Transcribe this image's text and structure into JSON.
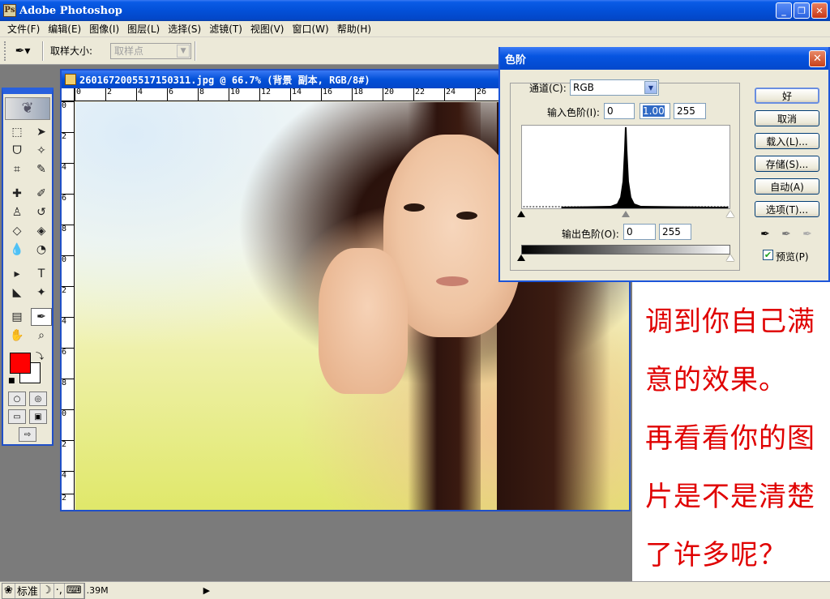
{
  "app": {
    "title": "Adobe Photoshop",
    "icon_glyph": "Ps"
  },
  "window_buttons": {
    "minimize": "_",
    "restore": "❐",
    "close": "✕"
  },
  "menu": [
    "文件(F)",
    "编辑(E)",
    "图像(I)",
    "图层(L)",
    "选择(S)",
    "滤镜(T)",
    "视图(V)",
    "窗口(W)",
    "帮助(H)"
  ],
  "options": {
    "sample_size_label": "取样大小:",
    "sample_size_value": "取样点",
    "tool_icon": "eyedropper-icon"
  },
  "document": {
    "title": "2601672005517150311.jpg @ 66.7% (背景 副本, RGB/8#)",
    "ruler_h": [
      "0",
      "2",
      "4",
      "6",
      "8",
      "10",
      "12",
      "14",
      "16",
      "18",
      "20",
      "22",
      "24",
      "26"
    ],
    "ruler_v": [
      "0",
      "2",
      "4",
      "6",
      "8",
      "0",
      "2",
      "4",
      "6",
      "8",
      "0",
      "2",
      "4",
      "2"
    ]
  },
  "levels_dialog": {
    "title": "色阶",
    "channel_label": "通道(C):",
    "channel_value": "RGB",
    "input_label": "输入色阶(I):",
    "input_black": "0",
    "input_gamma": "1.00",
    "input_white": "255",
    "output_label": "输出色阶(O):",
    "output_black": "0",
    "output_white": "255",
    "buttons": [
      "好",
      "取消",
      "载入(L)...",
      "存储(S)...",
      "自动(A)",
      "选项(T)..."
    ],
    "preview_label": "预览(P)",
    "preview_checked": true
  },
  "note": {
    "text": "调到你自己满意的效果。\n再看看你的图片是不是清楚了许多呢？"
  },
  "status": {
    "ime_mode": "标准",
    "size": ".39M",
    "arrow": "▶"
  },
  "colors": {
    "foreground": "#ff0000",
    "background": "#ffffff",
    "note_text": "#e00000",
    "title_blue": "#0350d8"
  }
}
